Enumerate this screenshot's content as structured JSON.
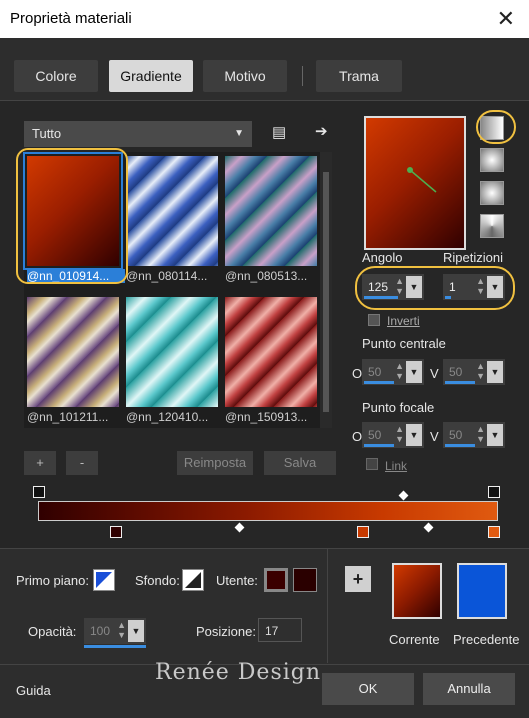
{
  "window": {
    "title": "Proprietà materiali",
    "close_glyph": "✕"
  },
  "tabs": [
    {
      "label": "Colore",
      "active": false
    },
    {
      "label": "Gradiente",
      "active": true
    },
    {
      "label": "Motivo",
      "active": false
    },
    {
      "label": "Trama",
      "active": false
    }
  ],
  "category": {
    "value": "Tutto"
  },
  "thumbnails": [
    {
      "label": "@nn_010914...",
      "selected": true
    },
    {
      "label": "@nn_080114...",
      "selected": false
    },
    {
      "label": "@nn_080513...",
      "selected": false
    },
    {
      "label": "@nn_101211...",
      "selected": false
    },
    {
      "label": "@nn_120410...",
      "selected": false
    },
    {
      "label": "@nn_150913...",
      "selected": false
    }
  ],
  "list_buttons": {
    "add": "+",
    "remove": "-",
    "reset": "Reimposta",
    "save": "Salva"
  },
  "angle": {
    "label": "Angolo",
    "value": "125"
  },
  "repeats": {
    "label": "Ripetizioni",
    "value": "1"
  },
  "invert": {
    "label": "Inverti",
    "checked": false
  },
  "center_point": {
    "label": "Punto centrale",
    "o_label": "O",
    "o_value": "50",
    "v_label": "V",
    "v_value": "50"
  },
  "focal_point": {
    "label": "Punto focale",
    "o_label": "O",
    "o_value": "50",
    "v_label": "V",
    "v_value": "50"
  },
  "link": {
    "label": "Link",
    "checked": false
  },
  "foreground": {
    "label": "Primo piano:"
  },
  "background": {
    "label": "Sfondo:"
  },
  "user": {
    "label": "Utente:"
  },
  "opacity": {
    "label": "Opacità:",
    "value": "100"
  },
  "position": {
    "label": "Posizione:",
    "value": "17"
  },
  "current": {
    "label": "Corrente"
  },
  "previous": {
    "label": "Precedente"
  },
  "footer": {
    "help": "Guida",
    "ok": "OK",
    "cancel": "Annulla"
  },
  "watermark": "Renée Design",
  "colors": {
    "accent": "#2b7fd8",
    "highlight": "#f0c040",
    "previous_swatch": "#0a55d8",
    "user_swatch": "#3a0000"
  }
}
